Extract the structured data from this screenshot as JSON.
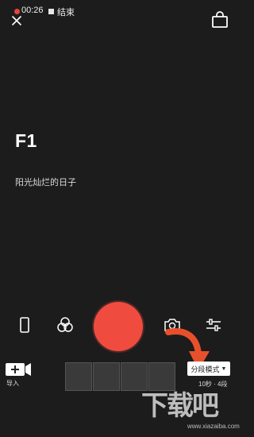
{
  "status": {
    "recording_time": "00:26",
    "end_label": "结束"
  },
  "filter": {
    "name": "F1",
    "description": "阳光灿烂的日子"
  },
  "toolbar": {
    "icons": [
      "phone-frame-icon",
      "filters-icon",
      "flip-camera-icon",
      "settings-sliders-icon"
    ]
  },
  "bottom": {
    "import_label": "导入",
    "mode_label": "分段模式",
    "mode_info": "10秒 · 4段"
  },
  "watermark": {
    "text": "下载吧",
    "url": "www.xiazaiba.com"
  },
  "colors": {
    "background": "#1c1c1c",
    "record": "#ef4c3f",
    "arrow": "#e8502c"
  }
}
